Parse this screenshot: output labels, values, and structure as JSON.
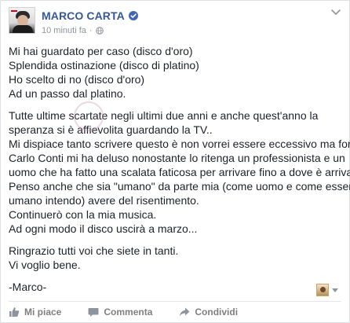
{
  "post": {
    "author": "MARCO CARTA",
    "timestamp": "10 minuti fa",
    "meta_separator": "·",
    "paragraphs": [
      [
        "Mi hai guardato per caso (disco d'oro)",
        "Splendida ostinazione (disco di platino)",
        "Ho scelto di no (disco d'oro)",
        "Ad un passo dal platino."
      ],
      [
        "Tutte ultime scartate negli ultimi due anni e anche quest'anno la",
        "speranza si è affievolita guardando la TV..",
        "Mi dispiace tanto scrivere questo è non vorrei essere eccessivo ma forse",
        "Carlo Conti mi ha deluso nonostante lo ritenga un professionista e un",
        "uomo che ha fatto una scalata faticosa per arrivare fino a dove è arrivato.",
        "Penso anche che sia \"umano\" da parte mia (come uomo e come essere",
        "umano intendo) avere del risentimento.",
        "Continuerò con la mia musica.",
        "Ad ogni modo il disco uscirà a marzo..."
      ],
      [
        "Ringrazio tutti voi che siete in tanti.",
        "Vi voglio bene."
      ],
      [
        "-Marco-"
      ]
    ]
  },
  "actions": {
    "like_label": "Mi piace",
    "comment_label": "Commenta",
    "share_label": "Condividi"
  },
  "icons": {
    "verified": "verified-badge-icon",
    "globe": "globe-icon",
    "chevron": "chevron-down-icon",
    "like": "thumbs-up-icon",
    "comment": "speech-bubble-icon",
    "share": "share-arrow-icon"
  },
  "colors": {
    "author": "#365899",
    "verified": "#4267b2",
    "meta": "#90949c",
    "text": "#1d2129",
    "action": "#7f7f7f"
  }
}
